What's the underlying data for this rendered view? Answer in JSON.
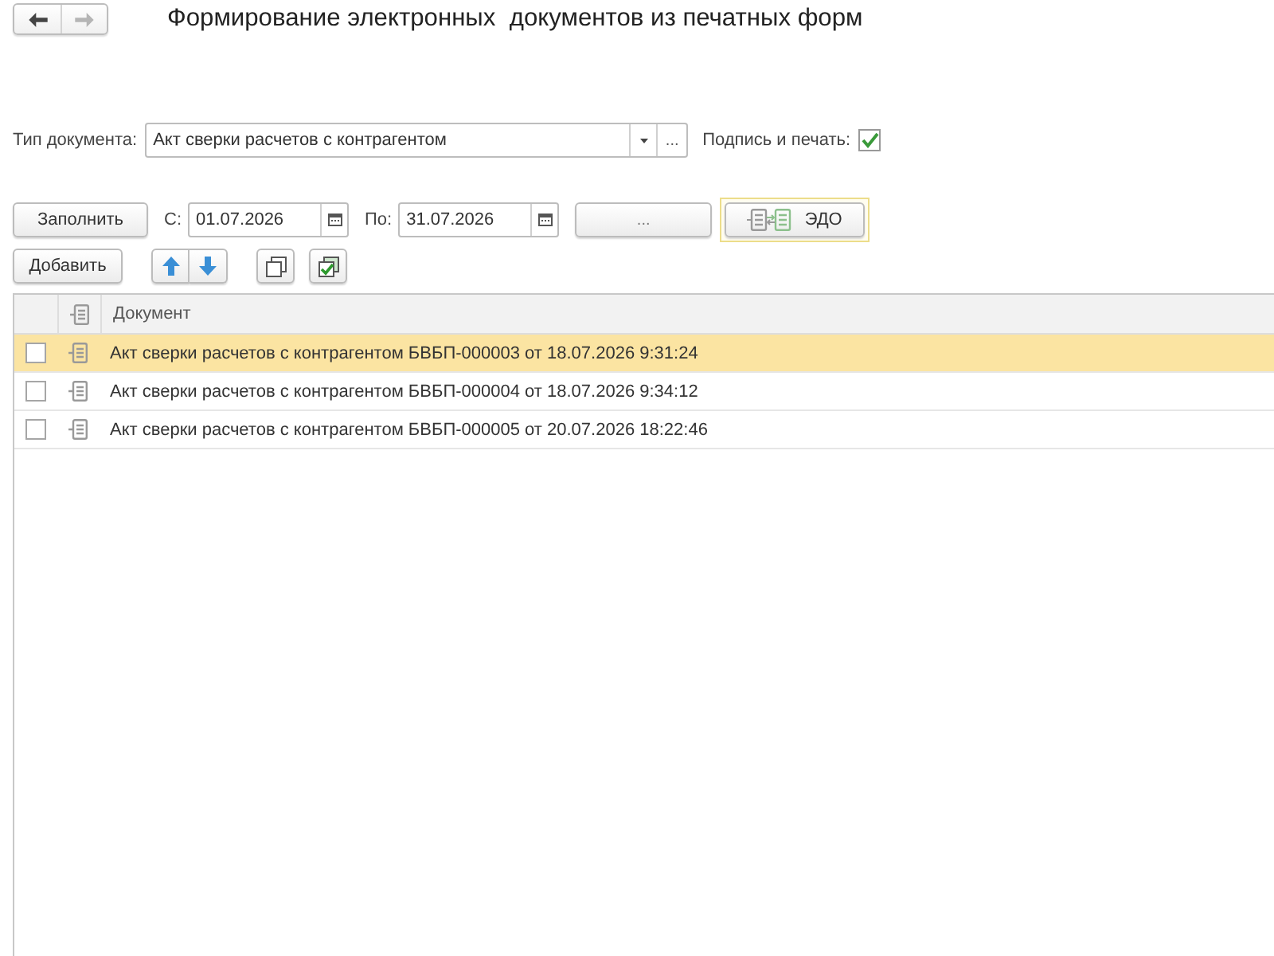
{
  "nav_buttons": [
    {
      "kind": "back",
      "disabled": false
    },
    {
      "kind": "forward",
      "disabled": true
    }
  ],
  "window": {
    "title": "Формирование электронных  документов из печатных форм"
  },
  "document_type": {
    "label": "Тип документа:",
    "value": "Акт сверки расчетов с контрагентом",
    "select_button": "..."
  },
  "signature": {
    "label": "Подпись и печать:",
    "checked": true
  },
  "period_bar": {
    "fill_button": "Заполнить",
    "from_label": "С:",
    "from_value": "01.07.2026",
    "to_label": "По:",
    "to_value": "31.07.2026",
    "period_button": "...",
    "edo_button": {
      "label": "ЭДО",
      "focused": true
    }
  },
  "list_toolbar": {
    "add_button": "Добавить",
    "tools": [
      {
        "kind": "up"
      },
      {
        "kind": "down"
      },
      {
        "kind": "copy"
      },
      {
        "kind": "check_all"
      }
    ]
  },
  "table": {
    "columns": [
      {
        "kind": "checkbox"
      },
      {
        "kind": "icon"
      },
      {
        "kind": "text",
        "label": "Документ"
      }
    ],
    "rows": [
      {
        "checked": false,
        "selected": true,
        "document": "Акт сверки расчетов с контрагентом БВБП-000003 от 18.07.2026 9:31:24"
      },
      {
        "checked": false,
        "selected": false,
        "document": "Акт сверки расчетов с контрагентом БВБП-000004 от 18.07.2026 9:34:12"
      },
      {
        "checked": false,
        "selected": false,
        "document": "Акт сверки расчетов с контрагентом БВБП-000005 от 20.07.2026 18:22:46"
      }
    ]
  }
}
